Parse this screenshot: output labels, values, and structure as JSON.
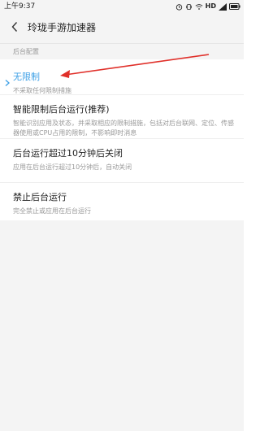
{
  "status_bar": {
    "time": "上午9:37",
    "network_label": "HD"
  },
  "app_bar": {
    "title": "玲珑手游加速器"
  },
  "section": {
    "header": "后台配置"
  },
  "options": [
    {
      "title": "无限制",
      "description": "不采取任何限制措施",
      "selected": true
    },
    {
      "title": "智能限制后台运行(推荐)",
      "description": "智能识别应用及状态，并采取相应的限制措施，包括对后台联网、定位、传感器使用或CPU占用的限制，不影响即时消息",
      "selected": false
    },
    {
      "title": "后台运行超过10分钟后关闭",
      "description": "应用在后台运行超过10分钟后，自动关闭",
      "selected": false
    },
    {
      "title": "禁止后台运行",
      "description": "完全禁止或应用在后台运行",
      "selected": false
    }
  ],
  "colors": {
    "selected_accent": "#3ea0e6",
    "annotation_arrow": "#e0302a"
  }
}
